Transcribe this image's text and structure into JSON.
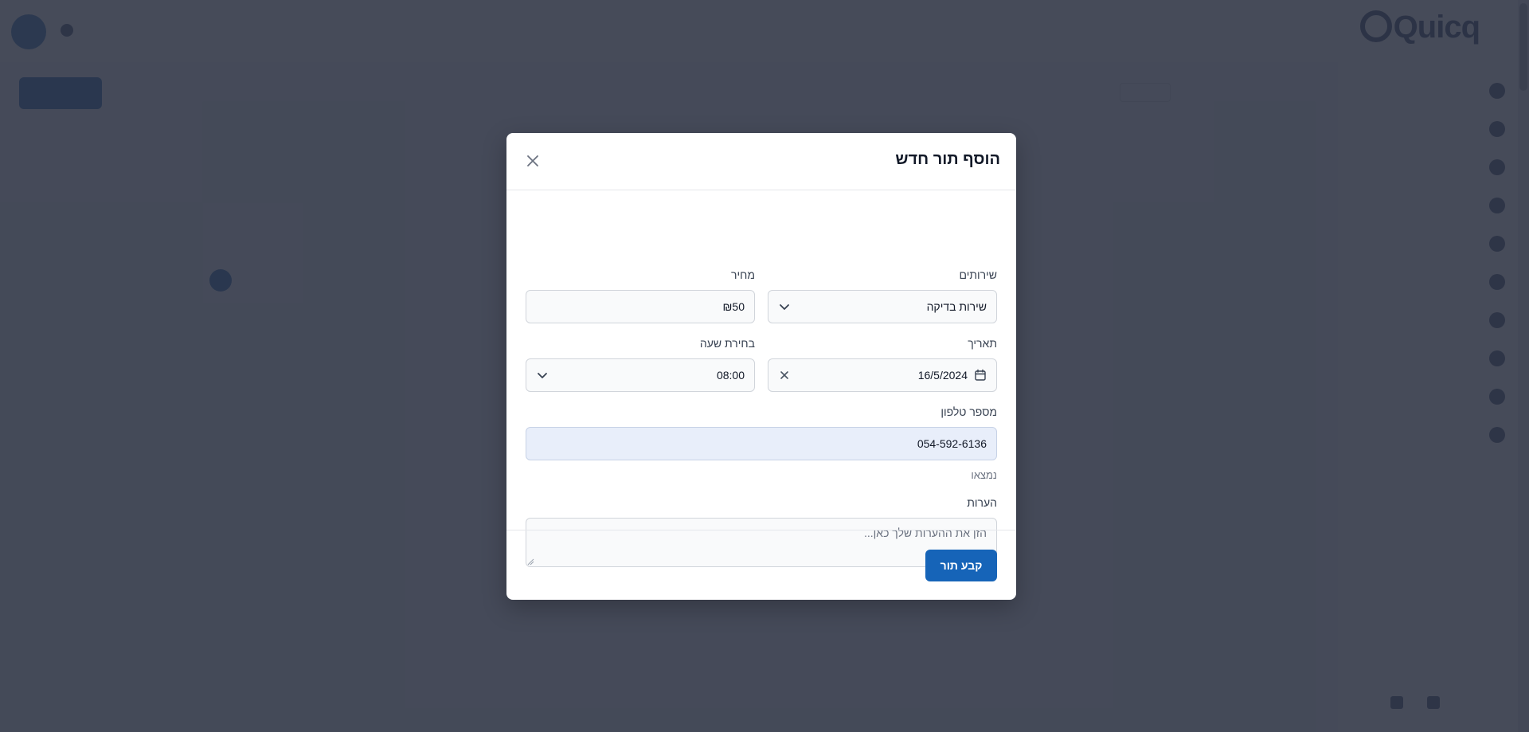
{
  "modal": {
    "title": "הוסף תור חדש",
    "services_label": "שירותים",
    "services_value": "שירות בדיקה",
    "price_label": "מחיר",
    "price_value": "₪50",
    "date_label": "תאריך",
    "date_value": "16/5/2024",
    "time_label": "בחירת שעה",
    "time_value": "08:00",
    "phone_label": "מספר טלפון",
    "phone_value": "054-592-6136",
    "phone_status": "נמצאו",
    "notes_label": "הערות",
    "notes_placeholder": "הזן את ההערות שלך כאן...",
    "submit_label": "קבע תור"
  },
  "icons": {
    "close": "close-icon",
    "services_dropdown": "chevron-down-icon",
    "time_dropdown": "chevron-down-icon",
    "date_calendar": "calendar-icon",
    "date_clear": "clear-icon"
  },
  "colors": {
    "primary": "#1664b8",
    "overlay": "#2c3242",
    "phone_field_bg": "#e8eefa"
  }
}
